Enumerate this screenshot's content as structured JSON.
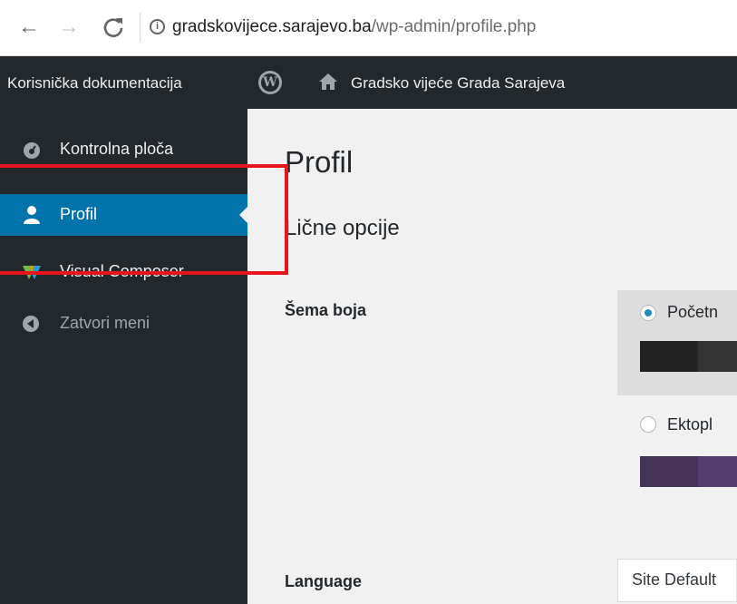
{
  "browser": {
    "url_host": "gradskovijece.sarajevo.ba",
    "url_path": "/wp-admin/profile.php"
  },
  "adminbar": {
    "documentation": "Korisnička dokumentacija",
    "site_name": "Gradsko vijeće Grada Sarajeva"
  },
  "sidebar": {
    "items": [
      {
        "label": "Kontrolna ploča",
        "icon": "dashboard-icon"
      },
      {
        "label": "Profil",
        "icon": "user-icon",
        "current": true
      },
      {
        "label": "Visual Composer",
        "icon": "visual-composer-icon"
      },
      {
        "label": "Zatvori meni",
        "icon": "collapse-icon"
      }
    ]
  },
  "main": {
    "title": "Profil",
    "section_title": "Lične opcije",
    "color_scheme": {
      "label": "Šema boja",
      "options": [
        {
          "name": "Početn",
          "selected": true,
          "colors": [
            "#222222",
            "#333333",
            "#0073aa"
          ]
        },
        {
          "name": "Ektopl",
          "selected": false,
          "colors": [
            "#413256",
            "#523f6d",
            "#a3b745"
          ]
        }
      ]
    },
    "language": {
      "label": "Language",
      "selected": "Site Default"
    }
  },
  "annotation_color": "#e8141b"
}
